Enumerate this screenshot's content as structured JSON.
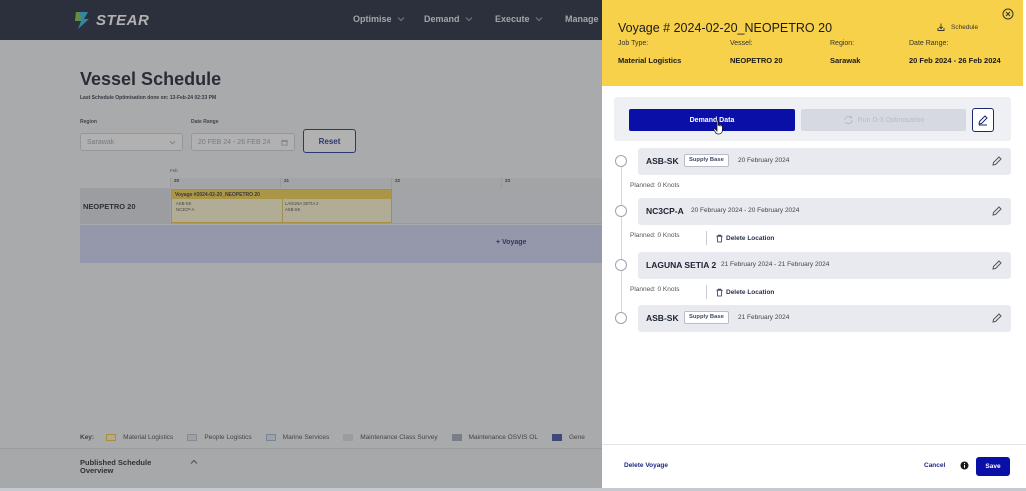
{
  "app": {
    "brand": "STEAR",
    "nav": [
      {
        "label": "Optimise"
      },
      {
        "label": "Demand"
      },
      {
        "label": "Execute"
      },
      {
        "label": "Manage"
      }
    ]
  },
  "schedule": {
    "title": "Vessel Schedule",
    "last_optimisation": "Last Schedule Optimisation done on: 13-Feb-24 02:33 PM",
    "region_label": "Region",
    "region_value": "Sarawak",
    "date_range_label": "Date Range",
    "date_range_value": "20 FEB 24 - 26 FEB 24",
    "reset_label": "Reset",
    "timeline": {
      "month": "Feb",
      "days": [
        "20",
        "21",
        "22",
        "23"
      ]
    },
    "vessel_name": "NEOPETRO 20",
    "voyage_block": {
      "title": "Voyage #2024-02-20_NEOPETRO 20",
      "col1": [
        "ASB-SK",
        "NC3CP-A"
      ],
      "col2": [
        "LAGUNA SETIA 2",
        "ASB-SK"
      ]
    },
    "add_voyage_label": "+ Voyage",
    "key": {
      "label": "Key:",
      "items": [
        {
          "label": "Material Logistics",
          "color": "#fff3c4"
        },
        {
          "label": "People Logistics",
          "color": "#dfe3ea"
        },
        {
          "label": "Marine Services",
          "color": "#dde7f2"
        },
        {
          "label": "Maintenance Class Survey",
          "color": "#d9dbe0"
        },
        {
          "label": "Maintenance OSVIS OL",
          "color": "#9fa6b6"
        },
        {
          "label": "Gene",
          "color": "#3b4a9c"
        }
      ]
    },
    "published_overview": "Published Schedule Overview"
  },
  "drawer": {
    "title": "Voyage # 2024-02-20_NEOPETRO 20",
    "schedule_link": "Schedule",
    "job_type_label": "Job Type:",
    "job_type_value": "Material Logistics",
    "vessel_label": "Vessel:",
    "vessel_value": "NEOPETRO 20",
    "region_label": "Region:",
    "region_value": "Sarawak",
    "date_range_label": "Date Range:",
    "date_range_value": "20 Feb 2024 - 26 Feb 2024",
    "demand_button": "Demand Data",
    "run_button": "Run D-3 Optimisation",
    "stops": [
      {
        "name": "ASB-SK",
        "badge": "Supply Base",
        "date": "20 February 2024"
      },
      {
        "name": "NC3CP-A",
        "badge": "",
        "date": "20 February 2024 - 20 February 2024"
      },
      {
        "name": "LAGUNA SETIA 2",
        "badge": "",
        "date": "21 February 2024 - 21 February 2024"
      },
      {
        "name": "ASB-SK",
        "badge": "Supply Base",
        "date": "21 February 2024"
      }
    ],
    "legs": [
      {
        "planned": "Planned: 0 Knots",
        "delete": ""
      },
      {
        "planned": "Planned: 0 Knots",
        "delete": "Delete Location"
      },
      {
        "planned": "Planned: 0 Knots",
        "delete": "Delete Location"
      }
    ],
    "delete_voyage": "Delete Voyage",
    "cancel": "Cancel",
    "save": "Save"
  }
}
